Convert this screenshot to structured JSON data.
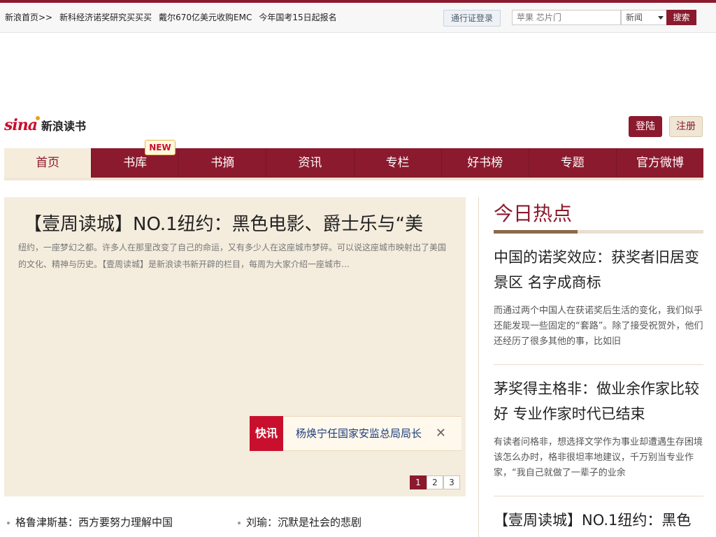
{
  "topbar": {
    "links": [
      "新浪首页>>",
      "新科经济诺奖研究买买买",
      "戴尔670亿美元收购EMC",
      "今年国考15日起报名"
    ],
    "login_pass": "通行证登录",
    "search_placeholder": "苹果 芯片门",
    "search_category": "新闻",
    "search_button": "搜索"
  },
  "header": {
    "logo_brand": "sina",
    "logo_name": "新浪读书",
    "login": "登陆",
    "register": "注册"
  },
  "nav": {
    "items": [
      "首页",
      "书库",
      "书摘",
      "资讯",
      "专栏",
      "好书榜",
      "专题",
      "官方微博"
    ],
    "new_badge": "NEW"
  },
  "feature": {
    "title": "【壹周读城】NO.1纽约：黑色电影、爵士乐与“美",
    "description": "纽约，一座梦幻之都。许多人在那里改变了自己的命运，又有多少人在这座城市梦碎。可以说这座城市映射出了美国的文化、精神与历史。【壹周读城】是新浪读书新开辟的栏目，每周为大家介绍一座城市…",
    "flash_label": "快讯",
    "flash_text": "杨焕宁任国家安监总局局长",
    "flash_close": "✕",
    "pages": [
      "1",
      "2",
      "3"
    ]
  },
  "bottom_links": [
    "格鲁津斯基：西方要努力理解中国",
    "刘瑜：沉默是社会的悲剧"
  ],
  "sidebar": {
    "title": "今日热点",
    "items": [
      {
        "headline": "中国的诺奖效应：获奖者旧居变景区 名字成商标",
        "summary": "而通过两个中国人在获诺奖后生活的变化，我们似乎还能发现一些固定的“套路”。除了接受祝贺外，他们还经历了很多其他的事，比如旧"
      },
      {
        "headline": "茅奖得主格非：做业余作家比较好 专业作家时代已结束",
        "summary": "有读者问格非，想选择文学作为事业却遭遇生存困境该怎么办时，格非很坦率地建议，千万别当专业作家，“我自己就做了一辈子的业余"
      },
      {
        "headline": "【壹周读城】NO.1纽约：黑色",
        "summary": ""
      }
    ]
  }
}
